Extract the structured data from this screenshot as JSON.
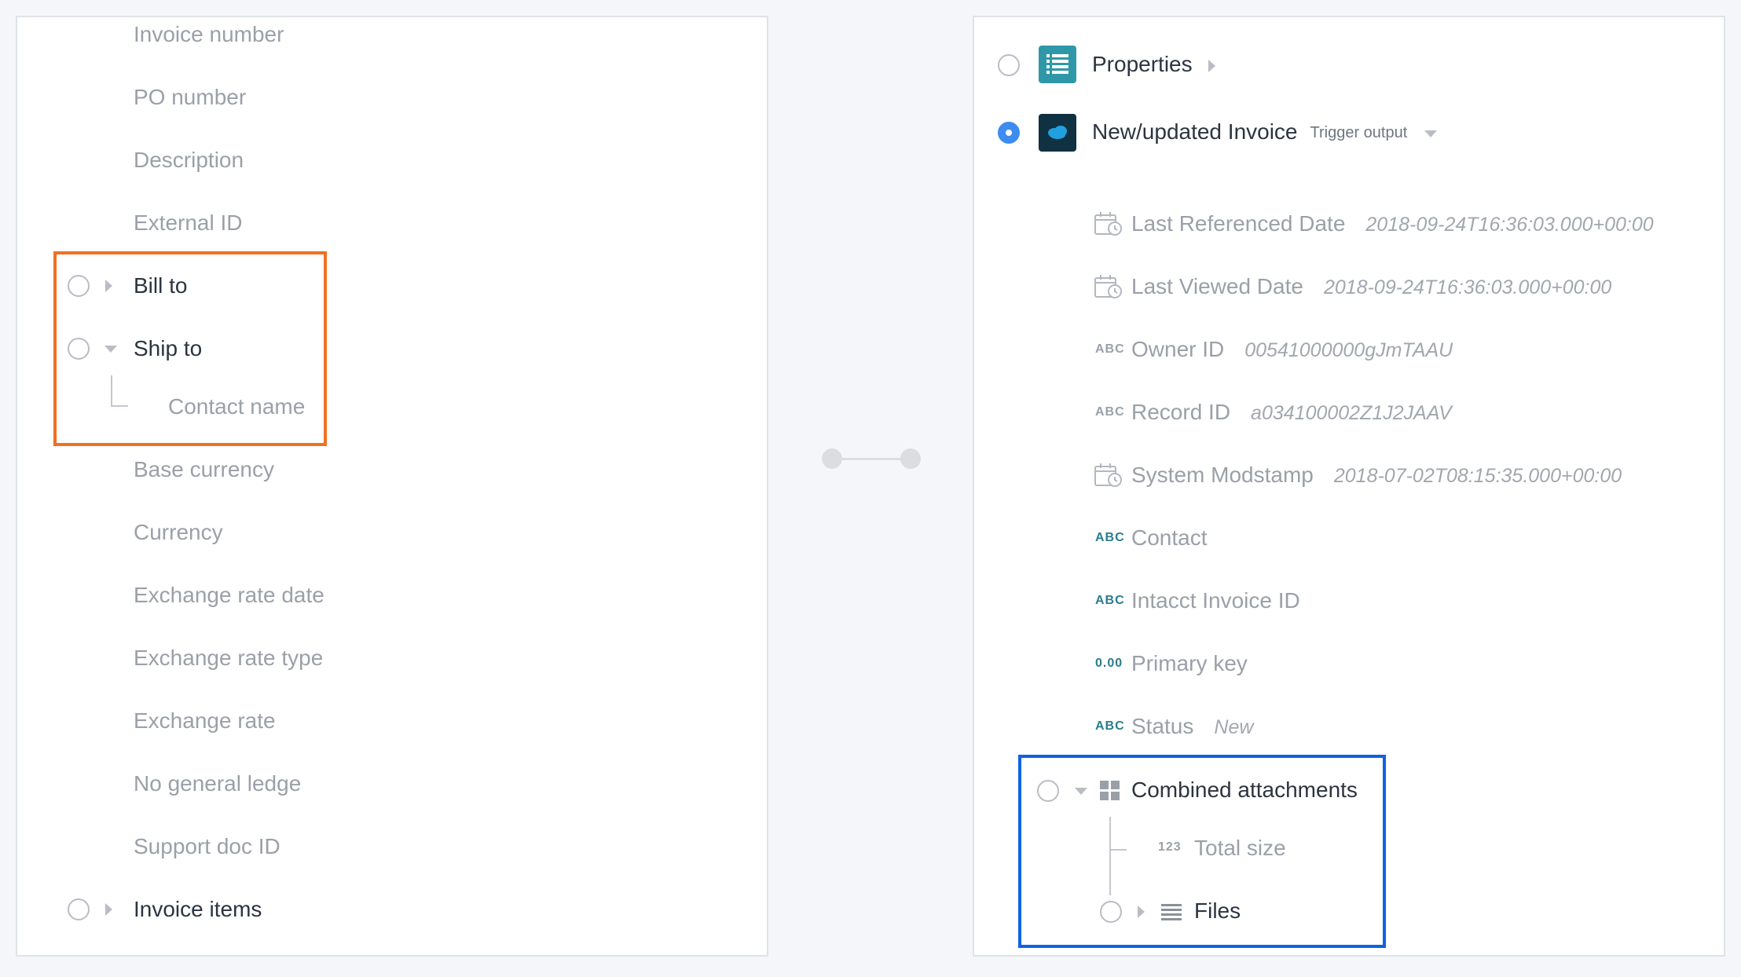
{
  "left": {
    "fields": {
      "invoice_number": "Invoice number",
      "po_number": "PO number",
      "description": "Description",
      "external_id": "External ID",
      "bill_to": "Bill to",
      "ship_to": "Ship to",
      "contact_name": "Contact name",
      "base_currency": "Base currency",
      "currency": "Currency",
      "exchange_rate_date": "Exchange rate date",
      "exchange_rate_type": "Exchange rate type",
      "exchange_rate": "Exchange rate",
      "no_general_ledge": "No general ledge",
      "support_doc_id": "Support doc ID",
      "invoice_items": "Invoice items"
    },
    "highlight_color": "#f26f21"
  },
  "right": {
    "properties_label": "Properties",
    "trigger": {
      "title": "New/updated Invoice",
      "label": "Trigger output",
      "selected": true
    },
    "fields": [
      {
        "icon": "calendar-icon",
        "name": "Last Referenced Date",
        "value": "2018-09-24T16:36:03.000+00:00"
      },
      {
        "icon": "calendar-icon",
        "name": "Last Viewed Date",
        "value": "2018-09-24T16:36:03.000+00:00"
      },
      {
        "icon": "abc",
        "name": "Owner ID",
        "value": "00541000000gJmTAAU"
      },
      {
        "icon": "abc",
        "name": "Record ID",
        "value": "a034100002Z1J2JAAV"
      },
      {
        "icon": "calendar-icon",
        "name": "System Modstamp",
        "value": "2018-07-02T08:15:35.000+00:00"
      },
      {
        "icon": "abc",
        "name": "Contact",
        "value": ""
      },
      {
        "icon": "abc",
        "name": "Intacct Invoice ID",
        "value": ""
      },
      {
        "icon": "0.00",
        "name": "Primary key",
        "value": ""
      },
      {
        "icon": "abc",
        "name": "Status",
        "value": "New"
      }
    ],
    "attachments": {
      "title": "Combined attachments",
      "total_size_icon": "123",
      "total_size": "Total size",
      "files": "Files"
    },
    "type_labels": {
      "abc": "ABC",
      "decimal": "0.00",
      "integer": "123"
    },
    "highlight_color": "#0f62e0"
  }
}
